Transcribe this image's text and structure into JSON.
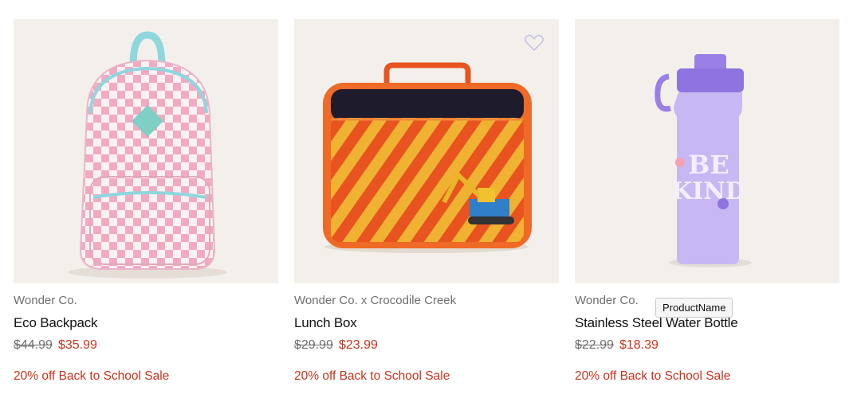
{
  "products": [
    {
      "brand": "Wonder Co.",
      "name": "Eco Backpack",
      "price_was": "$44.99",
      "price_now": "$35.99",
      "promo": "20% off Back to School Sale"
    },
    {
      "brand": "Wonder Co. x Crocodile Creek",
      "name": "Lunch Box",
      "price_was": "$29.99",
      "price_now": "$23.99",
      "promo": "20% off Back to School Sale"
    },
    {
      "brand": "Wonder Co.",
      "name": "Stainless Steel Water Bottle",
      "price_was": "$22.99",
      "price_now": "$18.39",
      "promo": "20% off Back to School Sale"
    }
  ],
  "bottle_print": {
    "line1": "BE",
    "line2": "KIND"
  },
  "tooltip": "ProductName",
  "colors": {
    "sale": "#c8331e",
    "muted": "#6f6f6f",
    "heart": "#c9c0e8"
  },
  "icons": {
    "wishlist": "heart-outline-icon"
  }
}
